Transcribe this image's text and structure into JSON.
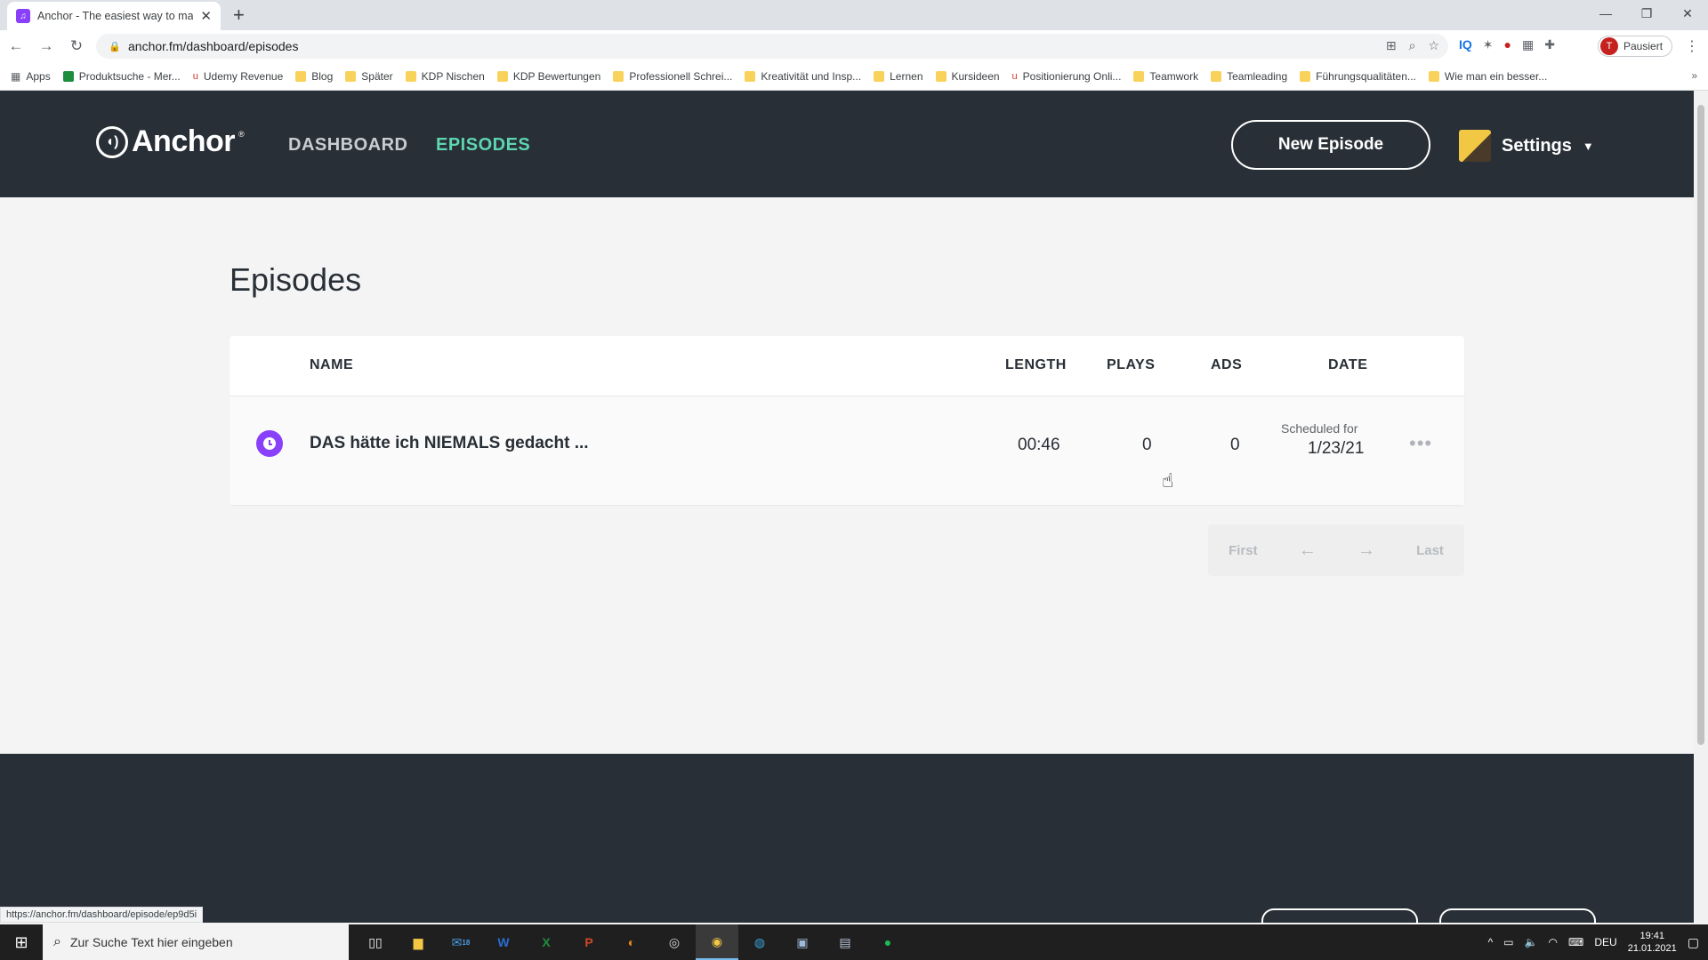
{
  "browser": {
    "tab_title": "Anchor - The easiest way to mak",
    "url": "anchor.fm/dashboard/episodes",
    "profile_initial": "T",
    "profile_label": "Pausiert",
    "status_url": "https://anchor.fm/dashboard/episode/ep9d5i"
  },
  "bookmarks": [
    {
      "label": "Apps"
    },
    {
      "label": "Produktsuche - Mer..."
    },
    {
      "label": "Udemy Revenue"
    },
    {
      "label": "Blog"
    },
    {
      "label": "Später"
    },
    {
      "label": "KDP Nischen"
    },
    {
      "label": "KDP Bewertungen"
    },
    {
      "label": "Professionell Schrei..."
    },
    {
      "label": "Kreativität und Insp..."
    },
    {
      "label": "Lernen"
    },
    {
      "label": "Kursideen"
    },
    {
      "label": "Positionierung Onli..."
    },
    {
      "label": "Teamwork"
    },
    {
      "label": "Teamleading"
    },
    {
      "label": "Führungsqualitäten..."
    },
    {
      "label": "Wie man ein besser..."
    }
  ],
  "header": {
    "logo_text": "Anchor",
    "nav_dashboard": "DASHBOARD",
    "nav_episodes": "EPISODES",
    "new_episode": "New Episode",
    "settings": "Settings"
  },
  "page": {
    "title": "Episodes"
  },
  "table": {
    "columns": {
      "name": "NAME",
      "length": "LENGTH",
      "plays": "PLAYS",
      "ads": "ADS",
      "date": "DATE"
    },
    "rows": [
      {
        "name": "DAS hätte ich NIEMALS gedacht ...",
        "length": "00:46",
        "plays": "0",
        "ads": "0",
        "date_label": "Scheduled for",
        "date": "1/23/21"
      }
    ]
  },
  "pager": {
    "first": "First",
    "last": "Last"
  },
  "taskbar": {
    "search_placeholder": "Zur Suche Text hier eingeben",
    "language": "DEU",
    "time": "19:41",
    "date": "21.01.2021",
    "mail_badge": "18"
  },
  "colors": {
    "anchor_purple": "#8940fa",
    "anchor_green": "#5cd6b0",
    "header_dark": "#292f36"
  }
}
